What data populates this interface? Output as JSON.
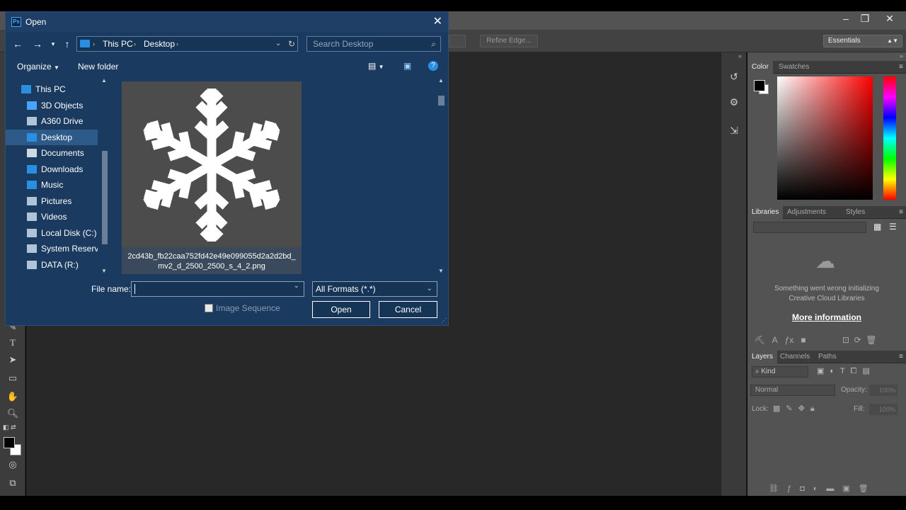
{
  "dialog": {
    "title": "Open",
    "close_glyph": "✕",
    "breadcrumb": [
      "This PC",
      "Desktop"
    ],
    "search_placeholder": "Search Desktop",
    "toolbar": {
      "organize_label": "Organize",
      "new_folder_label": "New folder"
    },
    "tree_items": [
      {
        "label": "This PC",
        "icon": "computer-icon",
        "color": "#2a8fe0"
      },
      {
        "label": "3D Objects",
        "icon": "cube-icon",
        "color": "#4aa3ff"
      },
      {
        "label": "A360 Drive",
        "icon": "cloud-drive-icon",
        "color": "#b0c4d8"
      },
      {
        "label": "Desktop",
        "icon": "desktop-icon",
        "color": "#2a8fe0",
        "selected": true
      },
      {
        "label": "Documents",
        "icon": "document-icon",
        "color": "#d0d8e0"
      },
      {
        "label": "Downloads",
        "icon": "download-icon",
        "color": "#2a8fe0"
      },
      {
        "label": "Music",
        "icon": "music-icon",
        "color": "#2a8fe0"
      },
      {
        "label": "Pictures",
        "icon": "pictures-icon",
        "color": "#b0c4d8"
      },
      {
        "label": "Videos",
        "icon": "video-icon",
        "color": "#b0c4d8"
      },
      {
        "label": "Local Disk (C:)",
        "icon": "disk-icon",
        "color": "#b0c4d8"
      },
      {
        "label": "System Reservec",
        "icon": "disk-icon",
        "color": "#b0c4d8"
      },
      {
        "label": "DATA (R:)",
        "icon": "disk-icon",
        "color": "#b0c4d8"
      }
    ],
    "file": {
      "name": "2cd43b_fb22caa752fd42e49e099055d2a2d2bd_mv2_d_2500_2500_s_4_2.png"
    },
    "filename_label": "File name:",
    "filename_value": "",
    "format_value": "All Formats (*.*)",
    "image_sequence_label": "Image Sequence",
    "open_label": "Open",
    "cancel_label": "Cancel"
  },
  "photoshop": {
    "refine_edge_label": "Refine Edge...",
    "workspace_value": "Essentials",
    "color_tabs": [
      "Color",
      "Swatches"
    ],
    "libraries_tabs": [
      "Libraries",
      "Adjustments",
      "Styles"
    ],
    "libraries_error": "Something went wrong initializing Creative Cloud Libraries",
    "more_info_label": "More information",
    "layers_tabs": [
      "Layers",
      "Channels",
      "Paths"
    ],
    "kind_label": "Kind",
    "blend_mode": "Normal",
    "opacity_label": "Opacity:",
    "opacity_value": "100%",
    "lock_label": "Lock:",
    "fill_label": "Fill:",
    "fill_value": "100%"
  },
  "colors": {
    "dialog_bg": "#1a3a60",
    "accent": "#2a8fe0",
    "ps_bg": "#282828"
  }
}
